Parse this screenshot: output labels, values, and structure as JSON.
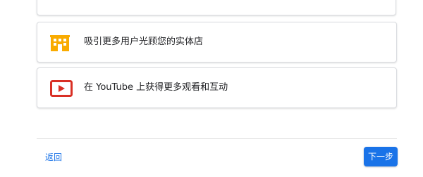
{
  "goals": [
    {
      "label": "吸引更多用户光顾您的实体店",
      "icon": "storefront-icon",
      "icon_color": "#f9ab00"
    },
    {
      "label": "在 YouTube 上获得更多观看和互动",
      "icon": "youtube-play-icon",
      "icon_color": "#d93025"
    }
  ],
  "footer": {
    "back_label": "返回",
    "next_label": "下一步"
  },
  "colors": {
    "accent": "#1a73e8",
    "card_border": "#dadce0",
    "text": "#202124"
  }
}
